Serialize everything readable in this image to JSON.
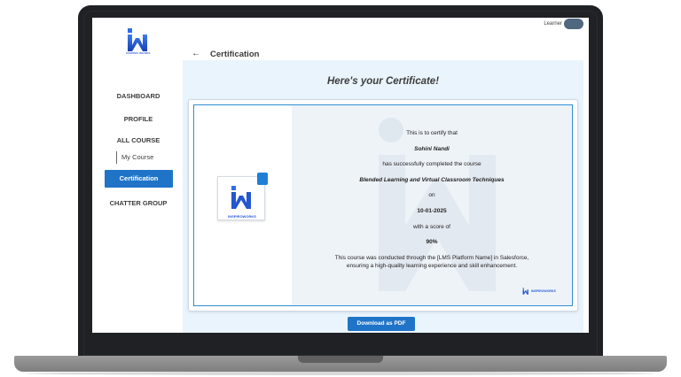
{
  "app": {
    "logo_text": "INSPIRO WORKS"
  },
  "header": {
    "user_role": "Learner",
    "page_title": "Certification",
    "back_symbol": "←"
  },
  "sidebar": {
    "items": [
      {
        "label": "DASHBOARD"
      },
      {
        "label": "PROFILE"
      },
      {
        "label": "ALL COURSE"
      },
      {
        "label": "My Course"
      },
      {
        "label": "Certification"
      },
      {
        "label": "CHATTER GROUP"
      }
    ],
    "active": "Certification"
  },
  "certificate": {
    "heading": "Here's your Certificate!",
    "line1": "This is to certify that",
    "name": "Sohini Nandi",
    "line2": "has successfully completed the course",
    "course": "Blended Learning and Virtual Classroom Techniques",
    "on": "on",
    "date": "10-01-2025",
    "score_label": "with a score of",
    "score": "90%",
    "paragraph": "This course was conducted through the [LMS Platform Name] in Salesforce, ensuring a high-quality learning experience and skill enhancement.",
    "badge_text": "INSPIROWORKS",
    "footer_logo_text": "INSPIROWORKS"
  },
  "actions": {
    "download_label": "Download as PDF"
  },
  "colors": {
    "primary": "#1f74c8",
    "panel_bg": "#e9f4fd",
    "cert_border": "#2f8ed3",
    "bezel": "#202124"
  }
}
